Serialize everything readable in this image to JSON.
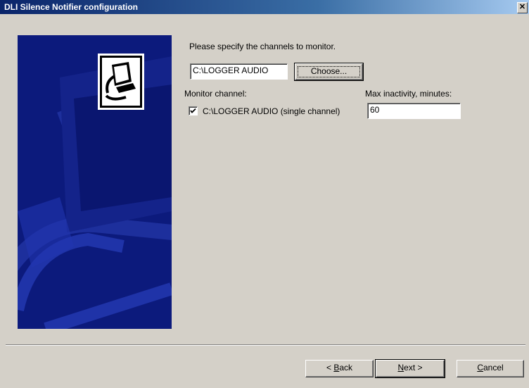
{
  "window": {
    "title": "DLI Silence Notifier configuration",
    "close_glyph": "✕"
  },
  "banner": {
    "icon": "computer-recycle-icon"
  },
  "instruction": "Please specify the channels to monitor.",
  "path_field": {
    "value": "C:\\LOGGER AUDIO"
  },
  "choose_button": {
    "label": "Choose..."
  },
  "monitor_label": "Monitor channel:",
  "inactivity_label": "Max inactivity, minutes:",
  "channels": [
    {
      "checked": true,
      "label": "C:\\LOGGER AUDIO (single channel)",
      "max_inactivity": "60"
    }
  ],
  "buttons": {
    "back": {
      "accel": "B",
      "rest": "ack",
      "prefix": "< "
    },
    "next": {
      "accel": "N",
      "rest": "ext >"
    },
    "cancel": {
      "accel": "C",
      "rest": "ancel"
    }
  },
  "colors": {
    "banner": "#0c1a7c",
    "title_start": "#0a246a",
    "title_end": "#a6caf0",
    "face": "#d4d0c8"
  }
}
